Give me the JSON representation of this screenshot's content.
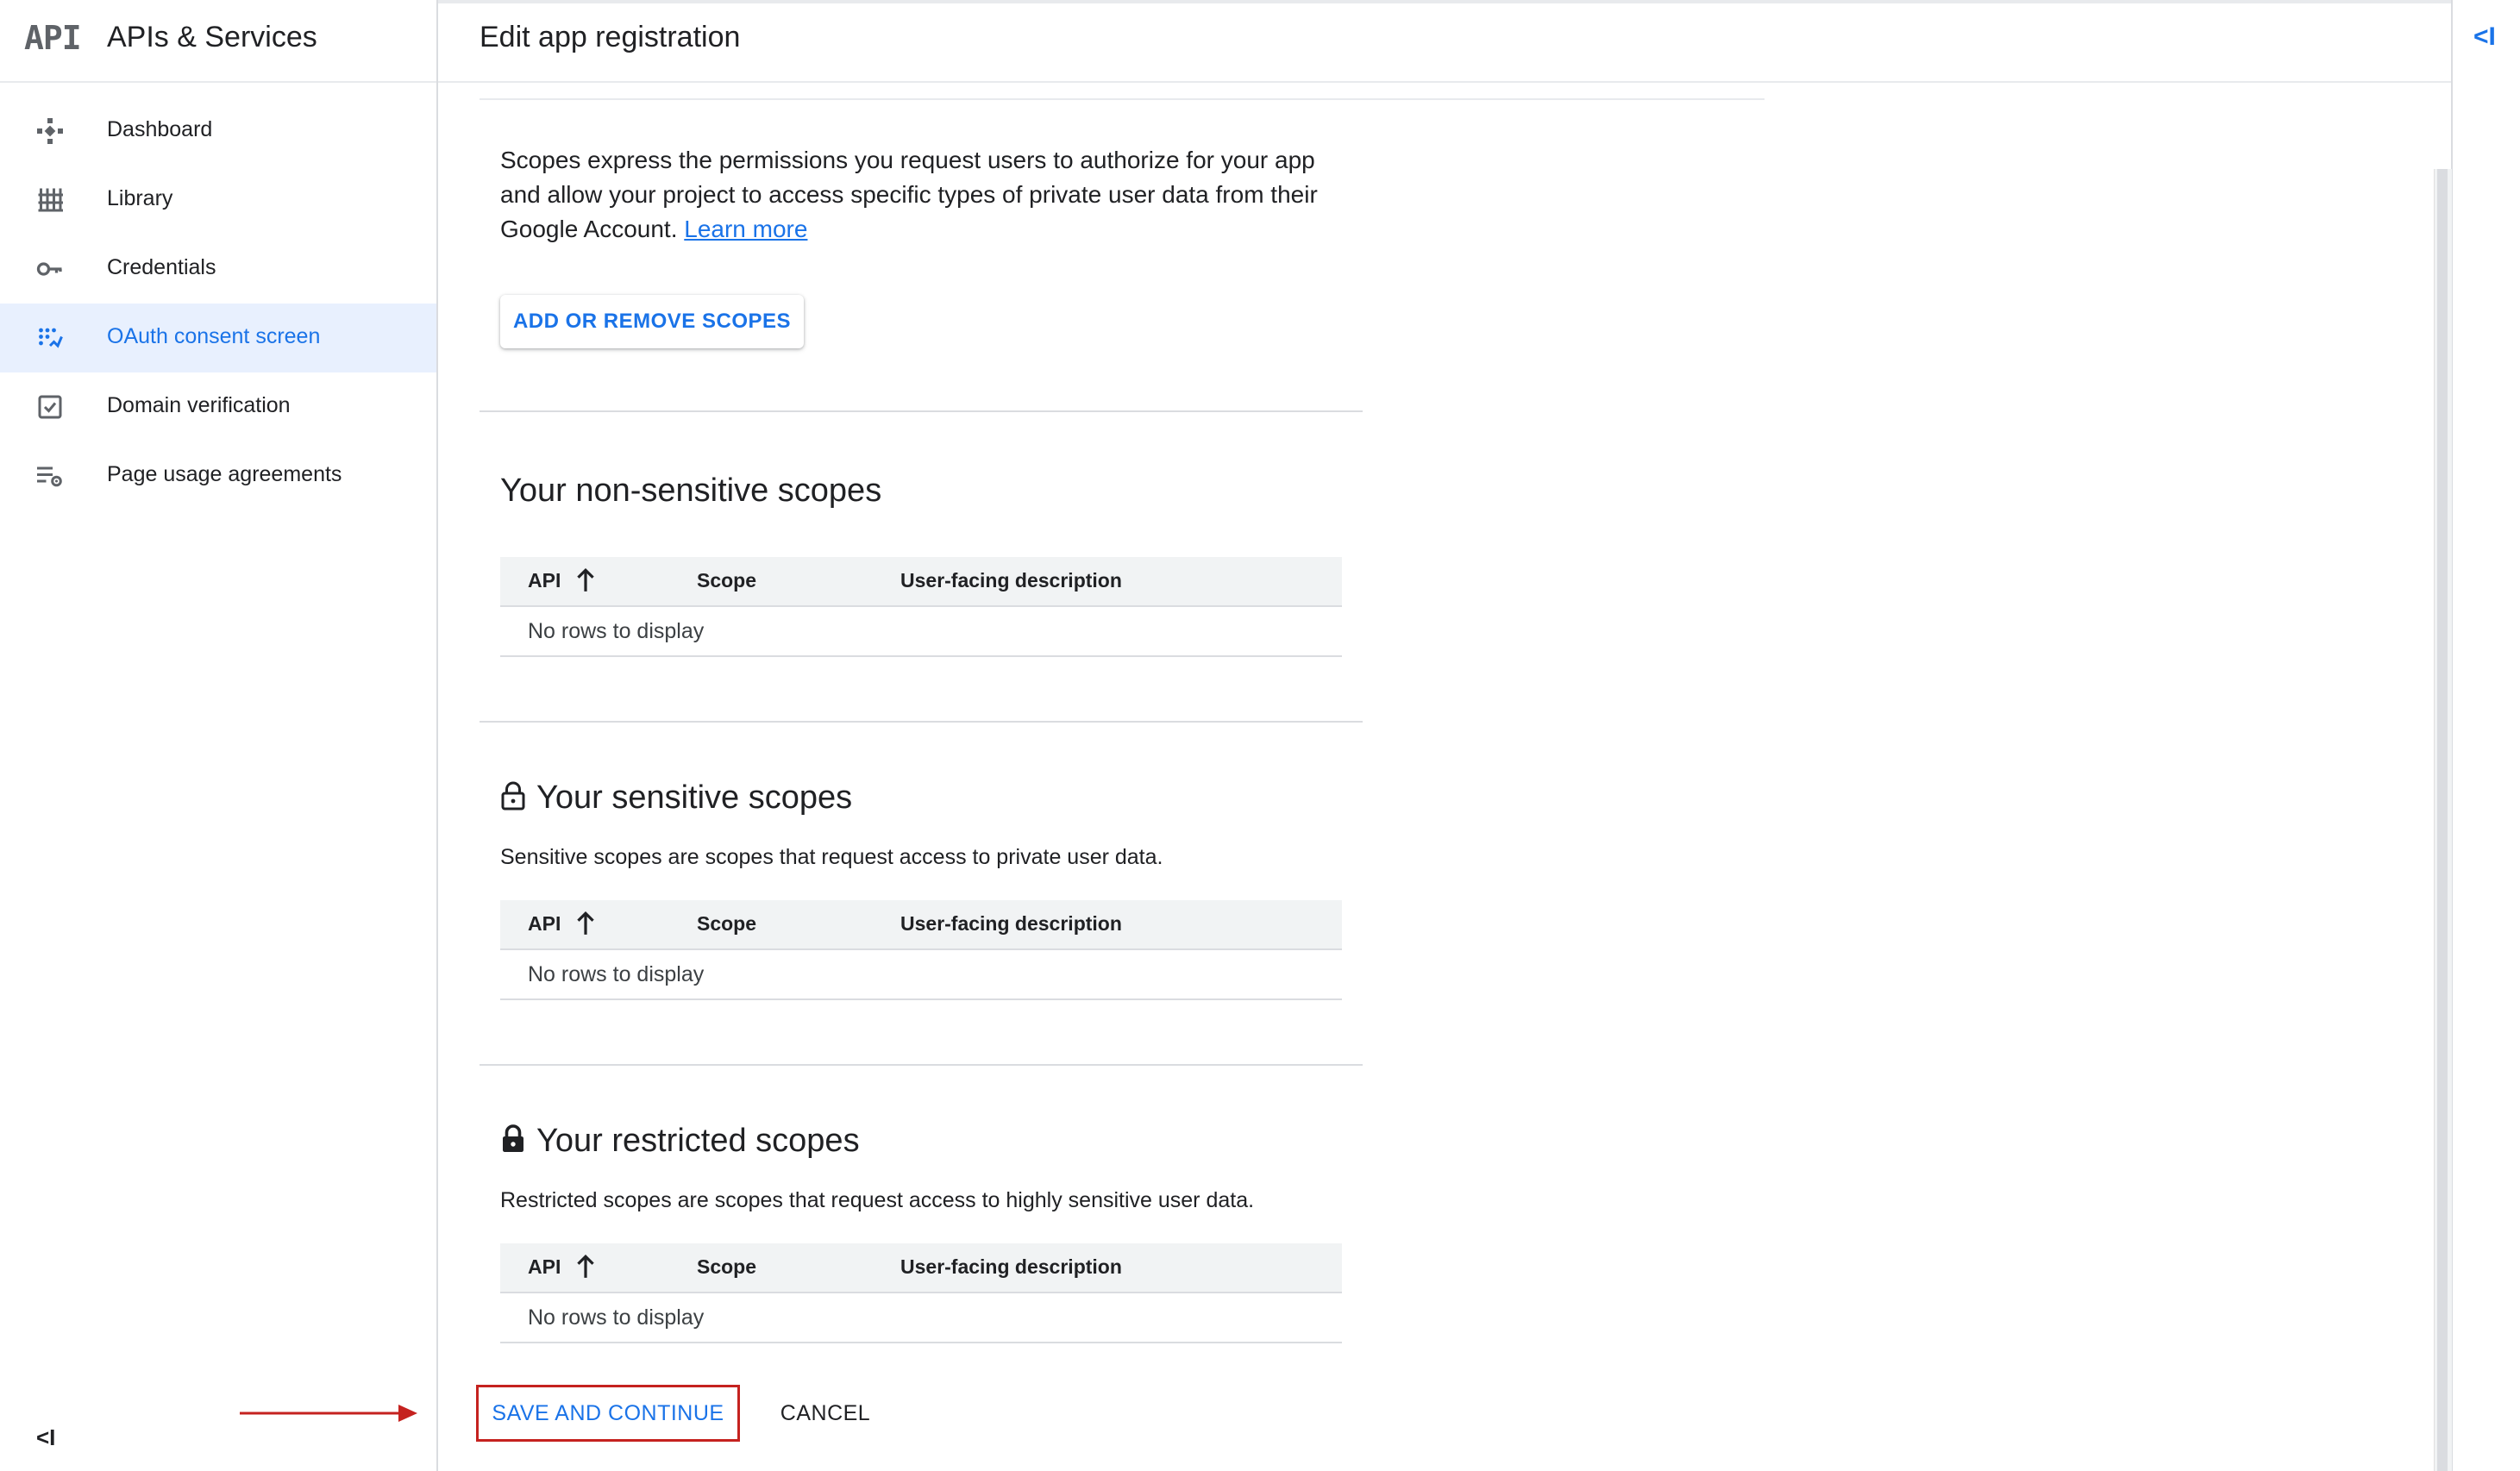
{
  "app": {
    "logo_text": "API",
    "title": "APIs & Services"
  },
  "sidebar": {
    "items": [
      {
        "label": "Dashboard",
        "icon": "dashboard-icon"
      },
      {
        "label": "Library",
        "icon": "library-icon"
      },
      {
        "label": "Credentials",
        "icon": "key-icon"
      },
      {
        "label": "OAuth consent screen",
        "icon": "oauth-consent-icon",
        "active": true
      },
      {
        "label": "Domain verification",
        "icon": "domain-verification-icon"
      },
      {
        "label": "Page usage agreements",
        "icon": "settings-list-icon"
      }
    ],
    "collapse_label": "<I"
  },
  "header": {
    "title": "Edit app registration"
  },
  "right_rail": {
    "collapse_label": "<I"
  },
  "main": {
    "intro_text": "Scopes express the permissions you request users to authorize for your app and allow your project to access specific types of private user data from their Google Account. ",
    "learn_more": "Learn more",
    "add_scopes_button": "ADD OR REMOVE SCOPES",
    "table_columns": {
      "api": "API",
      "scope": "Scope",
      "description": "User-facing description"
    },
    "sections": {
      "non_sensitive": {
        "title": "Your non-sensitive scopes",
        "empty": "No rows to display"
      },
      "sensitive": {
        "title": "Your sensitive scopes",
        "description": "Sensitive scopes are scopes that request access to private user data.",
        "empty": "No rows to display"
      },
      "restricted": {
        "title": "Your restricted scopes",
        "description": "Restricted scopes are scopes that request access to highly sensitive user data.",
        "empty": "No rows to display"
      }
    }
  },
  "footer": {
    "save_label": "SAVE AND CONTINUE",
    "cancel_label": "CANCEL"
  },
  "colors": {
    "accent": "#1a73e8",
    "active_bg": "#e8f0fe",
    "annotation": "#c5221f"
  }
}
